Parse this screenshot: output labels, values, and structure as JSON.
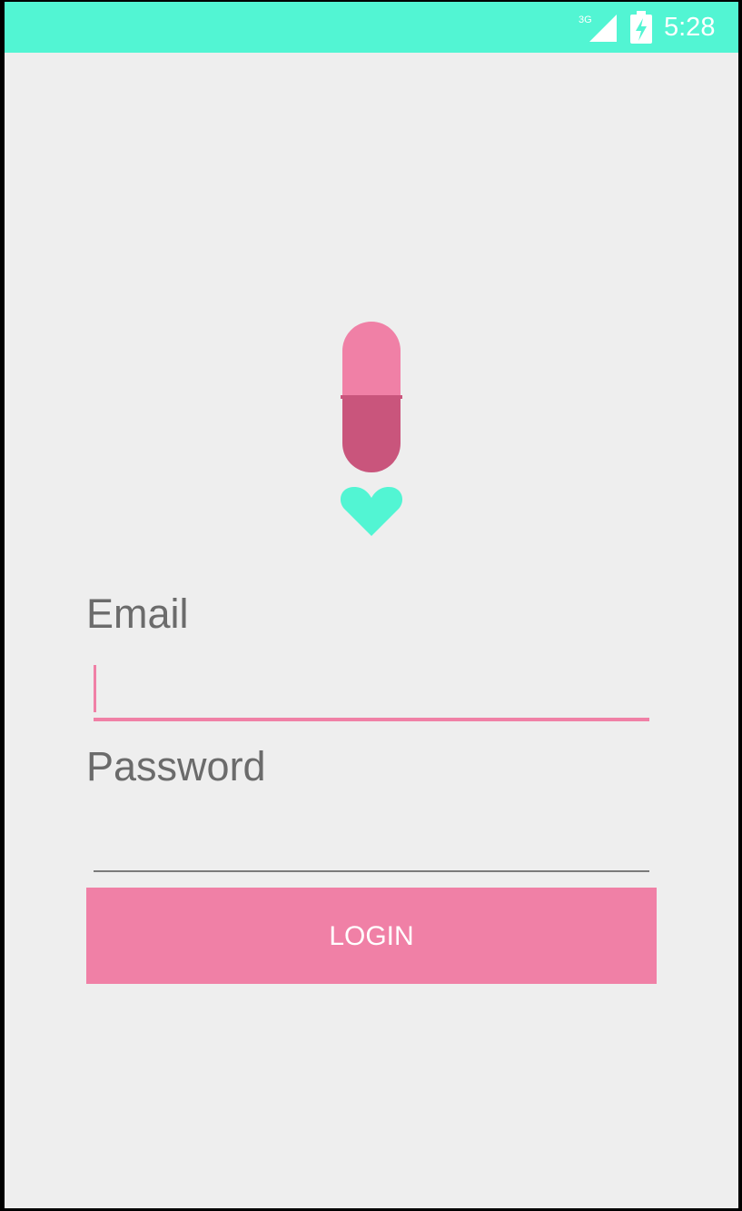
{
  "status_bar": {
    "network": "3G",
    "time": "5:28"
  },
  "icons": {
    "signal": "signal-3g-icon",
    "battery": "battery-charging-icon",
    "logo": "pill-heart-logo"
  },
  "form": {
    "email_label": "Email",
    "email_value": "",
    "password_label": "Password",
    "password_value": "",
    "login_label": "LOGIN"
  },
  "colors": {
    "status_bar": "#52f5d3",
    "background": "#eeeeee",
    "accent_pink": "#f080a6",
    "pill_dark": "#c9557c",
    "heart": "#52f5d3"
  }
}
